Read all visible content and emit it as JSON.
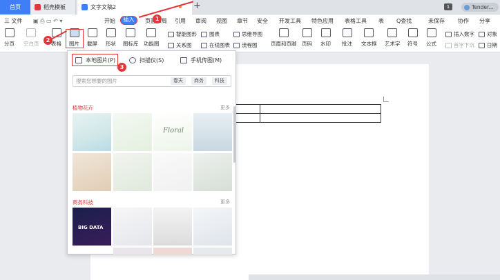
{
  "tabs": {
    "home": "首页",
    "template": "稻壳模板",
    "doc": "文字文稿2",
    "new_tab": "+"
  },
  "window": {
    "page_badge": "1",
    "user": "Tender..."
  },
  "menu": {
    "file": "三 文件",
    "items": [
      "开始",
      "插入",
      "页面布局",
      "引用",
      "审阅",
      "视图",
      "章节",
      "安全",
      "开发工具",
      "特色应用",
      "表格工具",
      "表"
    ],
    "search": "Q查找",
    "unsaved": "未保存",
    "collab": "协作",
    "share": "分享"
  },
  "toolbar": {
    "items": [
      "分页",
      "空白页",
      "表格",
      "图片",
      "截屏",
      "形状",
      "图标库",
      "功能图"
    ],
    "small": [
      "智能图形",
      "关系图",
      "图表",
      "在线图表",
      "思维导图",
      "流程图"
    ],
    "right": [
      "页眉和页脚",
      "页码",
      "水印",
      "批注",
      "文本框",
      "艺术字",
      "符号",
      "公式",
      "插入数字",
      "首字下沉",
      "对象",
      "日期"
    ]
  },
  "picture_panel": {
    "options": [
      "本地图片(P)",
      "扫描仪(S)",
      "手机传图(M)"
    ],
    "search_placeholder": "搜索您想要的图片",
    "tags": [
      "春天",
      "商务",
      "科技"
    ],
    "section1": "植物花卉",
    "section2": "商务科技",
    "more": "更多",
    "big_data_text": "BIG DATA",
    "floral_text": "Floral"
  },
  "annotations": [
    "1",
    "2",
    "3"
  ],
  "colors": {
    "accent": "#3f7ef6",
    "annotation": "#e0373b"
  }
}
